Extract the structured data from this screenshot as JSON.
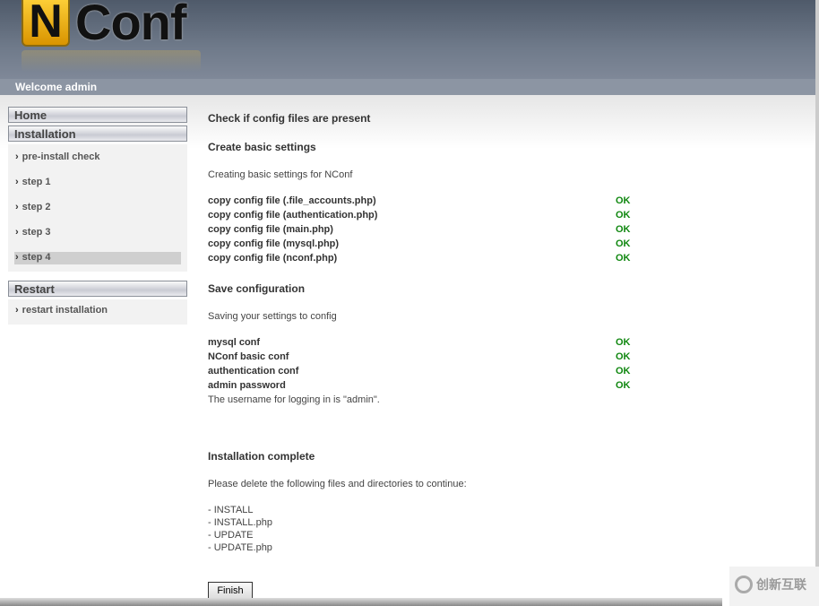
{
  "logo": {
    "text": "NConf"
  },
  "header": {
    "welcome": "Welcome admin"
  },
  "sidebar": {
    "home": "Home",
    "installation": {
      "title": "Installation",
      "items": [
        "pre-install check",
        "step 1",
        "step 2",
        "step 3",
        "step 4"
      ],
      "active": "step 4"
    },
    "restart": {
      "title": "Restart",
      "items": [
        "restart installation"
      ]
    }
  },
  "main": {
    "check_title": "Check if config files are present",
    "create_title": "Create basic settings",
    "create_desc": "Creating basic settings for NConf",
    "create_rows": [
      {
        "label": "copy config file (.file_accounts.php)",
        "status": "OK"
      },
      {
        "label": "copy config file (authentication.php)",
        "status": "OK"
      },
      {
        "label": "copy config file (main.php)",
        "status": "OK"
      },
      {
        "label": "copy config file (mysql.php)",
        "status": "OK"
      },
      {
        "label": "copy config file (nconf.php)",
        "status": "OK"
      }
    ],
    "save_title": "Save configuration",
    "save_desc": "Saving your settings to config",
    "save_rows": [
      {
        "label": "mysql conf",
        "status": "OK"
      },
      {
        "label": "NConf basic conf",
        "status": "OK"
      },
      {
        "label": "authentication conf",
        "status": "OK"
      },
      {
        "label": "admin password",
        "status": "OK"
      }
    ],
    "username_note": "The username for logging in is \"admin\".",
    "complete_title": "Installation complete",
    "complete_desc": "Please delete the following files and directories to continue:",
    "files": [
      "- INSTALL",
      "- INSTALL.php",
      "- UPDATE",
      "- UPDATE.php"
    ],
    "finish_label": "Finish"
  },
  "watermark": {
    "text": "创新互联"
  },
  "colors": {
    "ok": "#118811",
    "header": "#5f6a7a"
  }
}
